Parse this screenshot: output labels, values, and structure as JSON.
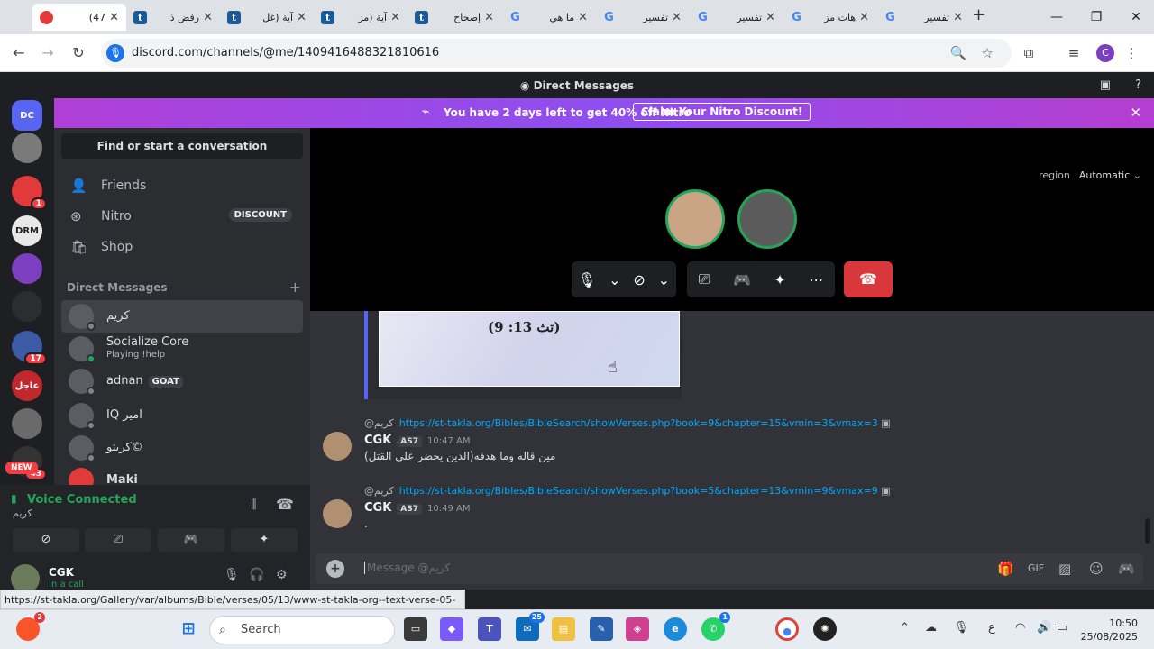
{
  "browser": {
    "tabs": [
      {
        "title": "(47",
        "favicon": "discord",
        "active": true
      },
      {
        "title": "رفض ذ",
        "favicon": "t"
      },
      {
        "title": "آية (غل",
        "favicon": "t"
      },
      {
        "title": "آية (مز",
        "favicon": "t"
      },
      {
        "title": "إصحاح",
        "favicon": "t"
      },
      {
        "title": "ما هي",
        "favicon": "G"
      },
      {
        "title": "تفسير",
        "favicon": "G"
      },
      {
        "title": "تفسير",
        "favicon": "G"
      },
      {
        "title": "هات مز",
        "favicon": "G"
      },
      {
        "title": "تفسير",
        "favicon": "G"
      }
    ],
    "new_tab": "+",
    "url": "discord.com/channels/@me/1409416488321810616",
    "profile_initial": "C",
    "status_url": "https://st-takla.org/Gallery/var/albums/Bible/verses/05/13/www-st-takla-org--text-verse-05-13-09.jpg"
  },
  "discord": {
    "top_title": "Direct Messages",
    "nitro_banner": {
      "text": "You have 2 days left to get 40% off Nitro",
      "button": "Claim Your Nitro Discount!"
    },
    "servers": [
      {
        "color": "#5865f2",
        "label": "DC"
      },
      {
        "color": "#7a7a7a",
        "label": "",
        "badge": ""
      },
      {
        "color": "#e03a3a",
        "label": "",
        "badge": "1"
      },
      {
        "color": "#e8e8e8",
        "label": "DRM",
        "badge": ""
      },
      {
        "color": "#7b3fbf",
        "label": "",
        "badge": ""
      },
      {
        "color": "#2b2d31",
        "label": "",
        "badge": ""
      },
      {
        "color": "#3b5ba5",
        "label": "",
        "badge": "17"
      },
      {
        "color": "#c0282d",
        "label": "عاجل",
        "badge": ""
      },
      {
        "color": "#6a6a6a",
        "label": "",
        "badge": ""
      },
      {
        "color": "#333",
        "label": "",
        "badge": "43"
      }
    ],
    "new_label": "NEW",
    "search_placeholder": "Find or start a conversation",
    "nav": [
      {
        "label": "Friends",
        "icon": "friends-icon"
      },
      {
        "label": "Nitro",
        "icon": "nitro-icon",
        "badge": "DISCOUNT"
      },
      {
        "label": "Shop",
        "icon": "shop-icon"
      }
    ],
    "dm_header": "Direct Messages",
    "dms": [
      {
        "name": "كريم",
        "sub": "",
        "online": false
      },
      {
        "name": "Socialize Core",
        "sub": "Playing !help",
        "online": true
      },
      {
        "name": "adnan",
        "sub": "",
        "online": false,
        "tag": "GOAT"
      },
      {
        "name": "IQ امير",
        "sub": "",
        "online": false
      },
      {
        "name": "كريتو©",
        "sub": "",
        "online": false
      },
      {
        "name": "Maki",
        "sub": "",
        "online": false
      }
    ],
    "voice": {
      "status": "Voice Connected",
      "channel": "كريم"
    },
    "user": {
      "name": "CGK",
      "status": "In a call"
    },
    "call": {
      "region_label": "region",
      "region_value": "Automatic"
    },
    "image_text": "(تث 13: 9)",
    "messages": [
      {
        "reply_to": "@كريم",
        "link": "https://st-takla.org/Bibles/BibleSearch/showVerses.php?book=9&chapter=15&vmin=3&vmax=3",
        "author": "CGK",
        "tag": "AS7",
        "time": "10:47 AM",
        "text": "مين قاله وما هدفه(الدين يحضر على القتل)"
      },
      {
        "reply_to": "@كريم",
        "link": "https://st-takla.org/Bibles/BibleSearch/showVerses.php?book=5&chapter=13&vmin=9&vmax=9",
        "author": "CGK",
        "tag": "AS7",
        "time": "10:49 AM",
        "text": "."
      }
    ],
    "input_placeholder": "Message @كريم"
  },
  "taskbar": {
    "search": "Search",
    "time": "10:50",
    "date": "25/08/2025",
    "lang": "ع",
    "badges": {
      "mail": "25",
      "whatsapp": "1",
      "brave": "2"
    }
  }
}
